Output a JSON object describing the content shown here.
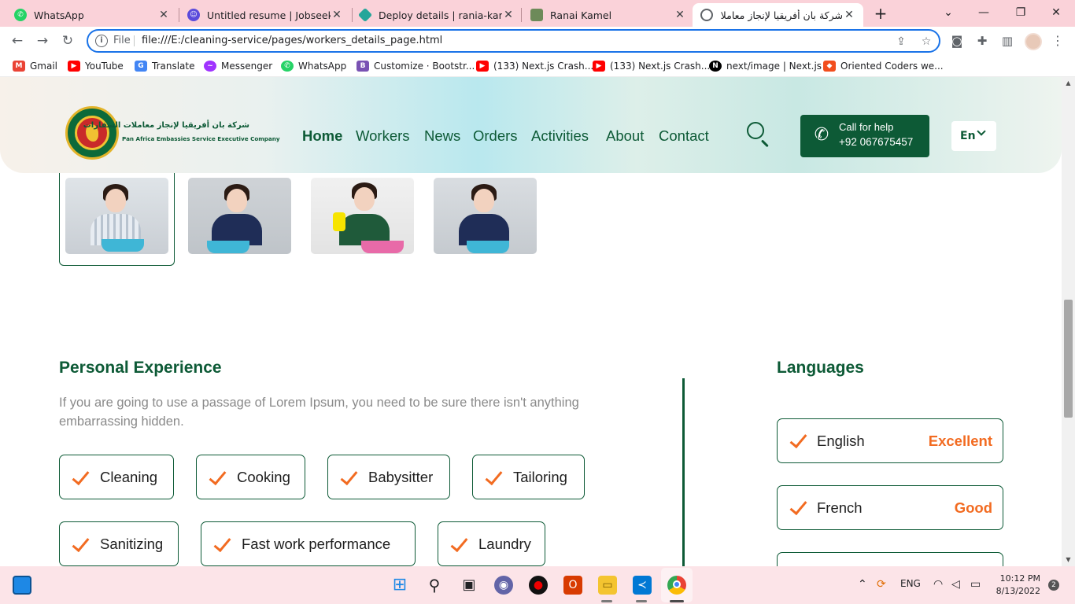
{
  "browser": {
    "tabs": [
      {
        "title": "WhatsApp",
        "icon": "whatsapp-icon",
        "color": "#25d366"
      },
      {
        "title": "Untitled resume | Jobseeker",
        "icon": "jobseeker-icon",
        "color": "#5b4bdb"
      },
      {
        "title": "Deploy details | rania-kamel-",
        "icon": "netlify-icon",
        "color": "#26a69a"
      },
      {
        "title": "Ranai Kamel",
        "icon": "portfolio-icon",
        "color": "#6d8a59"
      },
      {
        "title": "شركة بان أفريقيا لإنجاز معاملات",
        "icon": "globe-icon",
        "color": "#5f6368"
      }
    ],
    "address": {
      "scheme": "File",
      "url": "file:///E:/cleaning-service/pages/workers_details_page.html"
    },
    "bookmarks": [
      {
        "label": "Gmail",
        "icon": "gmail-icon",
        "color": "#ea4335"
      },
      {
        "label": "YouTube",
        "icon": "youtube-icon",
        "color": "#ff0000"
      },
      {
        "label": "Translate",
        "icon": "translate-icon",
        "color": "#4285f4"
      },
      {
        "label": "Messenger",
        "icon": "messenger-icon",
        "color": "#a033ff"
      },
      {
        "label": "WhatsApp",
        "icon": "whatsapp-icon",
        "color": "#25d366"
      },
      {
        "label": "Customize · Bootstr...",
        "icon": "bootstrap-icon",
        "color": "#7952b3"
      },
      {
        "label": "(133) Next.js Crash...",
        "icon": "youtube-icon",
        "color": "#ff0000"
      },
      {
        "label": "(133) Next.js Crash...",
        "icon": "youtube-icon",
        "color": "#ff0000"
      },
      {
        "label": "next/image | Next.js",
        "icon": "nextjs-icon",
        "color": "#000000"
      },
      {
        "label": "Oriented Coders we...",
        "icon": "figma-icon",
        "color": "#f24e1e"
      }
    ]
  },
  "site": {
    "brand_ar": "شركة بان أفريقيا لإنجاز معاملات السفارات",
    "brand_en": "Pan Africa Embassies Service Executive Company",
    "nav": [
      "Home",
      "Workers",
      "News",
      "Orders",
      "Activities",
      "About",
      "Contact"
    ],
    "call_label": "Call for help",
    "call_number": "+92 067675457",
    "language": "En"
  },
  "personal_experience": {
    "title": "Personal Experience",
    "description": "If you are going to use a passage of Lorem Ipsum, you need to be sure there isn't anything embarrassing hidden.",
    "skills": [
      "Cleaning",
      "Cooking",
      "Babysitter",
      "Tailoring",
      "Sanitizing",
      "Fast work performance",
      "Laundry"
    ]
  },
  "languages": {
    "title": "Languages",
    "items": [
      {
        "name": "English",
        "level": "Excellent"
      },
      {
        "name": "French",
        "level": "Good"
      }
    ]
  },
  "taskbar": {
    "lang": "ENG",
    "time": "10:12 PM",
    "date": "8/13/2022",
    "notifications": "2"
  },
  "colors": {
    "brand_green": "#0d5a36",
    "accent_orange": "#f26b21",
    "tab_bar": "#fad2d9"
  }
}
